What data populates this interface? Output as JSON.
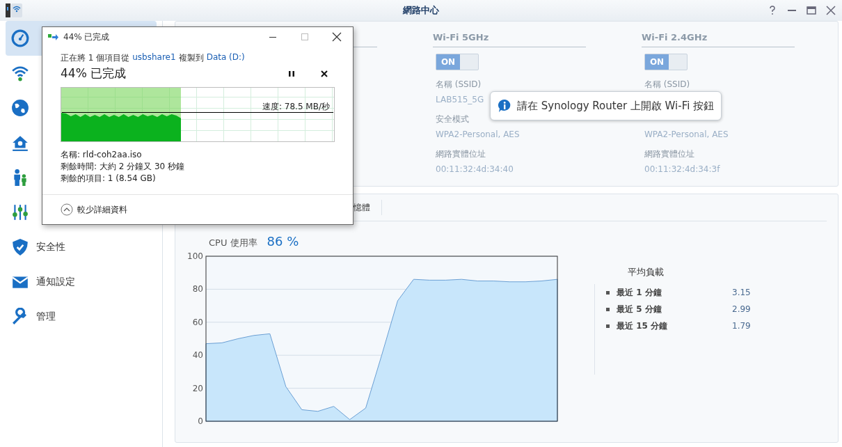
{
  "window": {
    "title": "網路中心"
  },
  "sidebar": {
    "items": [
      {
        "selected": true
      },
      {
        "selected": false
      },
      {
        "selected": false
      },
      {
        "selected": false
      },
      {
        "selected": false
      },
      {
        "selected": false
      },
      {
        "label": "安全性",
        "selected": false
      },
      {
        "label": "通知設定",
        "selected": false
      },
      {
        "label": "管理",
        "selected": false
      }
    ]
  },
  "wifi": {
    "columns": [
      {
        "heading": "Wi-Fi 5GHz",
        "toggle": "ON",
        "on": true,
        "fields": [
          {
            "label": "名稱 (SSID)",
            "value": "LAB515_5G"
          },
          {
            "label": "安全模式",
            "value": "WPA2-Personal, AES"
          },
          {
            "label": "網路實體位址",
            "value": "00:11:32:4d:34:40"
          }
        ]
      },
      {
        "heading": "Wi-Fi 2.4GHz",
        "toggle": "ON",
        "on": true,
        "fields": [
          {
            "label": "名稱 (SSID)"
          },
          {
            "value": "WPA2-Personal, AES"
          },
          {
            "label": "網路實體位址",
            "value": "00:11:32:4d:34:3f"
          }
        ]
      }
    ]
  },
  "tooltip": {
    "text": "請在 Synology Router 上開啟 Wi-Fi 按鈕"
  },
  "monitor": {
    "tabs": [
      {
        "label": "憶體",
        "selected": false
      }
    ],
    "cpu_label": "CPU 使用率",
    "cpu_value": "86 %",
    "chart_data": {
      "type": "area",
      "grid": true,
      "ylim": [
        0,
        100
      ],
      "yticks": [
        0,
        20,
        40,
        60,
        80,
        100
      ],
      "series": [
        {
          "color": "#6a9fd4",
          "values": [
            47,
            47.5,
            50,
            52,
            53,
            21,
            7,
            6,
            9,
            1,
            8,
            40,
            73,
            86,
            85.5,
            85.5,
            86,
            85,
            85,
            84.5,
            84.5,
            85,
            86
          ]
        }
      ]
    },
    "load": {
      "title": "平均負載",
      "rows": [
        {
          "label": "最近 1 分鐘",
          "value": "3.15"
        },
        {
          "label": "最近 5 分鐘",
          "value": "2.99"
        },
        {
          "label": "最近 15 分鐘",
          "value": "1.79"
        }
      ]
    }
  },
  "copy_dialog": {
    "title": "44% 已完成",
    "line_start": "正在將 1 個項目從",
    "source": "usbshare1",
    "line_mid": "複製到",
    "target": "Data (D:)",
    "heading": "44% 已完成",
    "progress": {
      "level": 0.44
    },
    "speed": "速度: 78.5 MB/秒",
    "details": [
      "名稱: rld-coh2aa.iso",
      "剩餘時間: 大約 2 分鐘又 30 秒鐘",
      "剩餘的項目: 1 (8.54 GB)"
    ],
    "toggle_label": "較少詳細資料"
  }
}
